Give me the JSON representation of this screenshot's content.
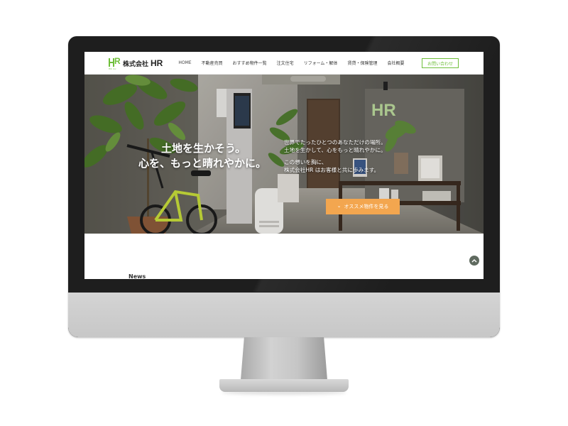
{
  "header": {
    "logo": {
      "mark": "R",
      "mark_sub": "HR inc",
      "company": "株式会社",
      "name": "HR"
    },
    "nav": [
      {
        "label": "HOME"
      },
      {
        "label": "不動産売買"
      },
      {
        "label": "おすすめ物件一覧"
      },
      {
        "label": "注文住宅"
      },
      {
        "label": "リフォーム・解体"
      },
      {
        "label": "賃貸・保険管理"
      },
      {
        "label": "会社概要"
      }
    ],
    "contact_label": "お問い合わせ"
  },
  "hero": {
    "title_line1": "土地を生かそう。",
    "title_line2": "心を、もっと晴れやかに。",
    "copy_line1": "世界でたったひとつのあなただけの場所。",
    "copy_line2": "土地を生かして、心をもっと晴れやかに。",
    "copy_line3": "この想いを胸に、",
    "copy_line4": "株式会社HR はお客様と共に歩みます。",
    "cta_label": "オススメ物件を見る",
    "wall_logo": "HR"
  },
  "content": {
    "section_label": "News"
  },
  "colors": {
    "brand_green": "#6fbf3a",
    "cta_orange": "#f3a64f"
  },
  "icons": {
    "cta": "chevron-down-icon",
    "scroll_top": "chevron-up-icon"
  }
}
